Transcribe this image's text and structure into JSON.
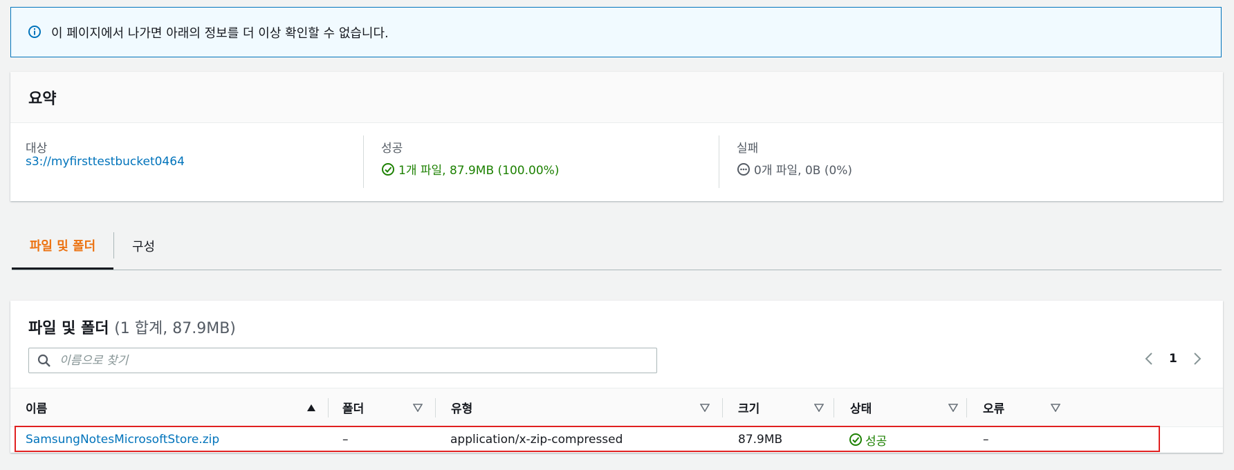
{
  "alert": {
    "icon": "info-icon",
    "text": "이 페이지에서 나가면 아래의 정보를 더 이상 확인할 수 없습니다."
  },
  "summary": {
    "title": "요약",
    "destination": {
      "label": "대상",
      "value": "s3://myfirsttestbucket0464"
    },
    "succeeded": {
      "label": "성공",
      "value": "1개 파일, 87.9MB (100.00%)",
      "icon": "success-check-icon"
    },
    "failed": {
      "label": "실패",
      "value": "0개 파일, 0B (0%)",
      "icon": "pending-dots-icon"
    }
  },
  "tabs": [
    {
      "label": "파일 및 폴더",
      "active": true
    },
    {
      "label": "구성",
      "active": false
    }
  ],
  "files": {
    "title": "파일 및 폴더",
    "count": "(1 합계, 87.9MB)",
    "search_placeholder": "이름으로 찾기",
    "page": "1",
    "columns": [
      {
        "label": "이름",
        "sort": "ascending"
      },
      {
        "label": "폴더",
        "sort": "none"
      },
      {
        "label": "유형",
        "sort": "none"
      },
      {
        "label": "크기",
        "sort": "none"
      },
      {
        "label": "상태",
        "sort": "none"
      },
      {
        "label": "오류",
        "sort": "none"
      }
    ],
    "rows": [
      {
        "name": "SamsungNotesMicrosoftStore.zip",
        "folder": "–",
        "type": "application/x-zip-compressed",
        "size": "87.9MB",
        "status": "성공",
        "error": "–"
      }
    ]
  },
  "colors": {
    "link": "#0073bb",
    "success": "#1d8102",
    "active_tab": "#ec7211",
    "highlight_border": "#e02020",
    "alert_border": "#0073bb",
    "alert_bg": "#f1faff"
  }
}
